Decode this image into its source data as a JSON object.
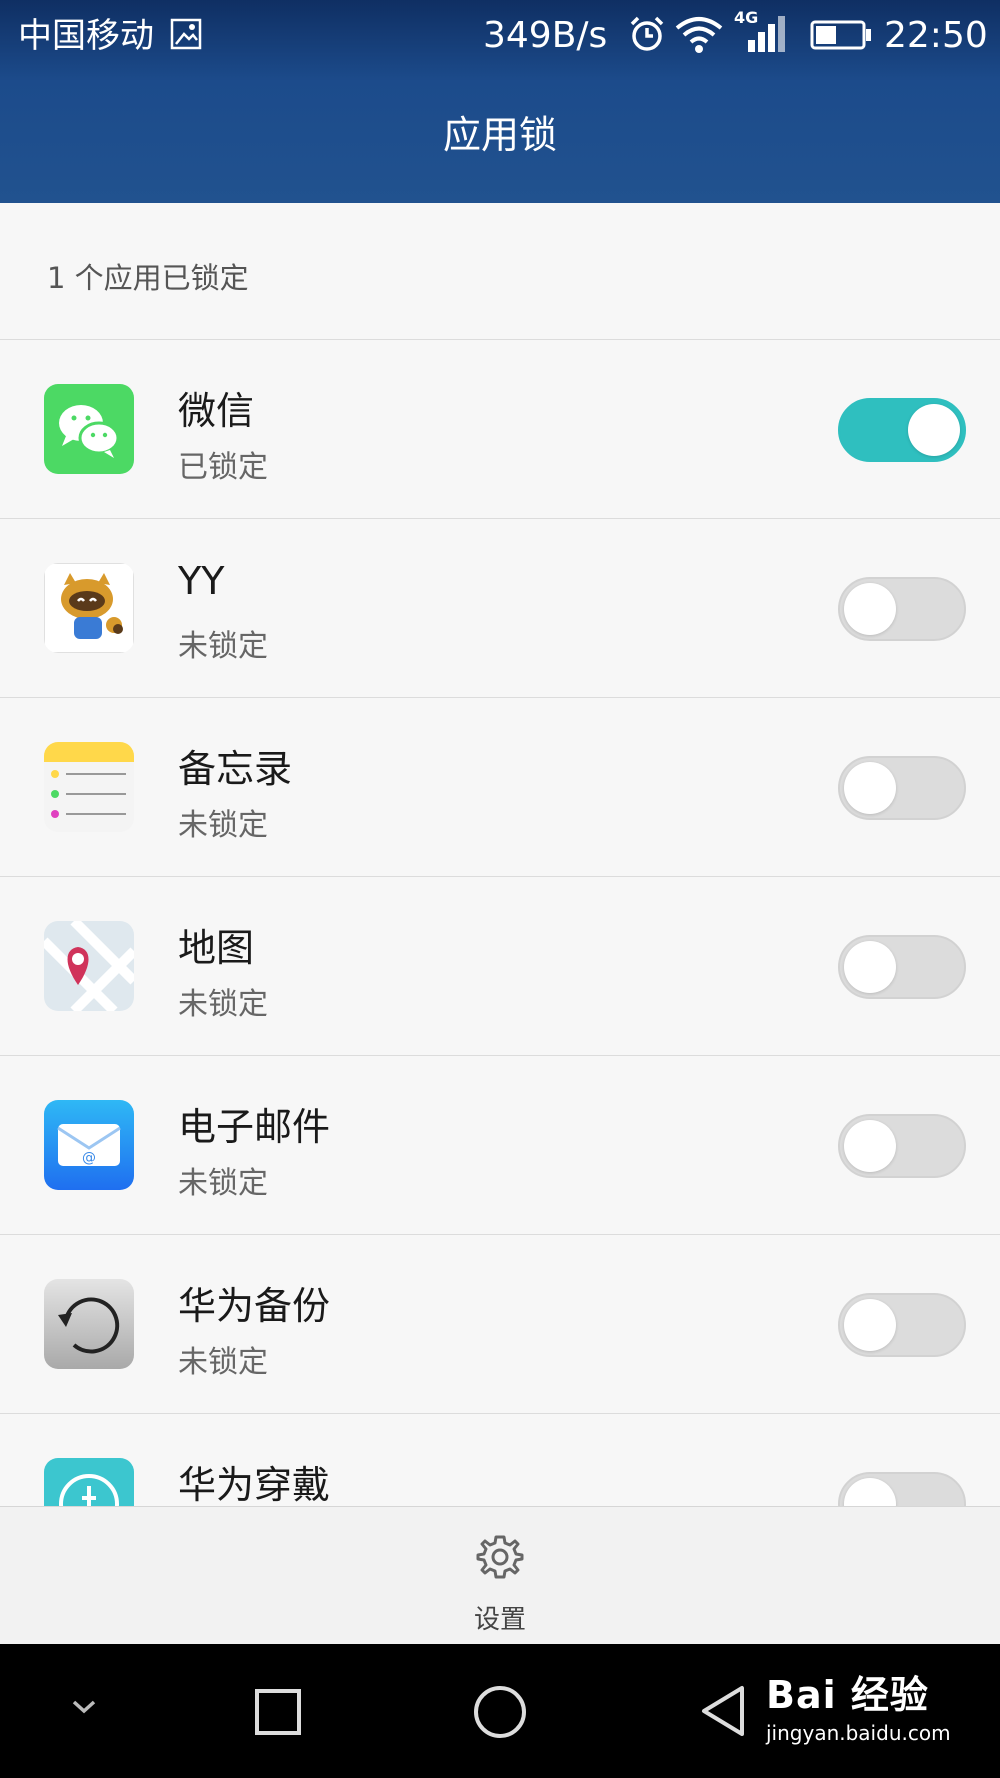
{
  "status_bar": {
    "carrier": "中国移动",
    "net_speed": "349B/s",
    "network_type": "4G",
    "time": "22:50"
  },
  "header": {
    "title": "应用锁"
  },
  "summary": "1 个应用已锁定",
  "apps": [
    {
      "name": "微信",
      "status": "已锁定",
      "icon": "wechat-icon",
      "locked": true
    },
    {
      "name": "YY",
      "status": "未锁定",
      "icon": "yy-icon",
      "locked": false
    },
    {
      "name": "备忘录",
      "status": "未锁定",
      "icon": "notes-icon",
      "locked": false
    },
    {
      "name": "地图",
      "status": "未锁定",
      "icon": "map-icon",
      "locked": false
    },
    {
      "name": "电子邮件",
      "status": "未锁定",
      "icon": "email-icon",
      "locked": false
    },
    {
      "name": "华为备份",
      "status": "未锁定",
      "icon": "backup-icon",
      "locked": false
    },
    {
      "name": "华为穿戴",
      "status": "",
      "icon": "wear-icon",
      "locked": false
    }
  ],
  "bottom": {
    "settings_label": "设置"
  },
  "watermark": {
    "main": "Bai 经验",
    "sub": "jingyan.baidu.com"
  },
  "colors": {
    "header": "#21528f",
    "toggle_on": "#2fbfbf",
    "toggle_off": "#dcdcdc"
  }
}
